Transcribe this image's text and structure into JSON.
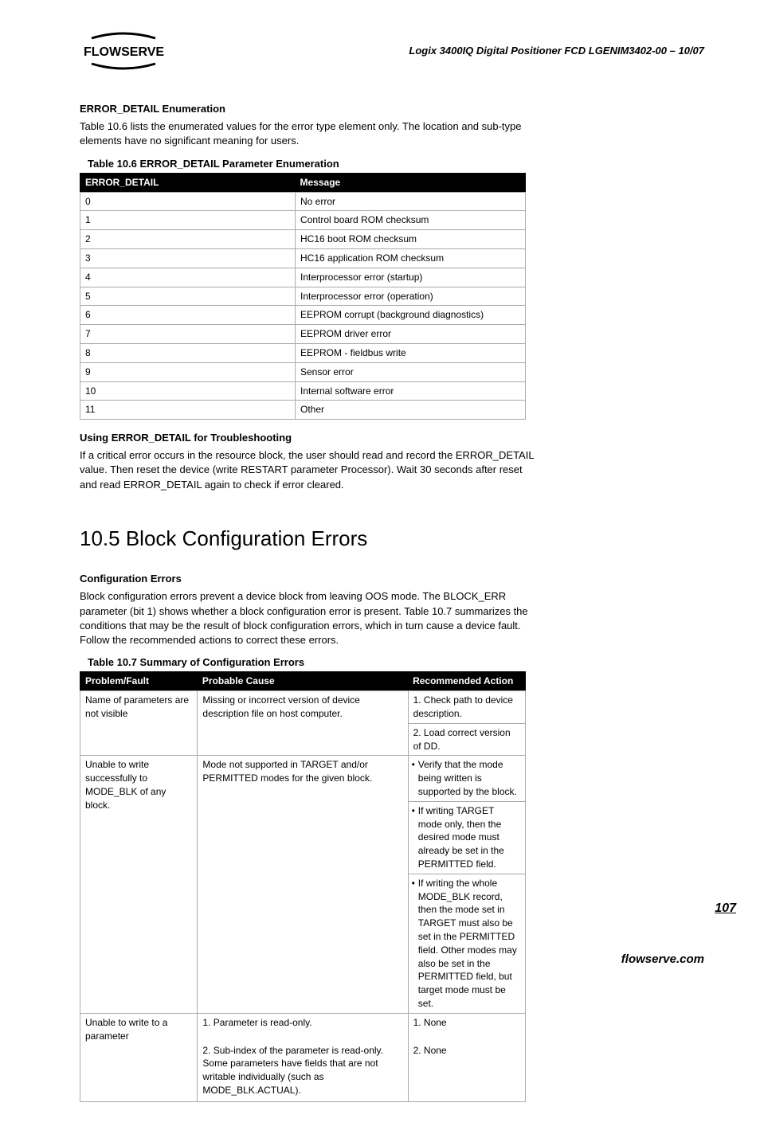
{
  "header": {
    "doc_id": "Logix 3400IQ Digital Positioner   FCD LGENIM3402-00 – 10/07"
  },
  "sec1_title": "ERROR_DETAIL Enumeration",
  "sec1_para": "Table 10.6 lists the enumerated values for the error type element only. The location and sub-type elements have no significant meaning for users.",
  "table106_caption": "Table 10.6 ERROR_DETAIL Parameter Enumeration",
  "table106_head": {
    "c1": "ERROR_DETAIL",
    "c2": "Message"
  },
  "table106_rows": [
    {
      "c1": "0",
      "c2": "No error"
    },
    {
      "c1": "1",
      "c2": "Control board ROM checksum"
    },
    {
      "c1": "2",
      "c2": "HC16 boot ROM checksum"
    },
    {
      "c1": "3",
      "c2": "HC16 application ROM checksum"
    },
    {
      "c1": "4",
      "c2": "Interprocessor error (startup)"
    },
    {
      "c1": "5",
      "c2": "Interprocessor error (operation)"
    },
    {
      "c1": "6",
      "c2": "EEPROM corrupt (background diagnostics)"
    },
    {
      "c1": "7",
      "c2": "EEPROM driver error"
    },
    {
      "c1": "8",
      "c2": "EEPROM - fieldbus write"
    },
    {
      "c1": "9",
      "c2": "Sensor error"
    },
    {
      "c1": "10",
      "c2": "Internal software error"
    },
    {
      "c1": "11",
      "c2": "Other"
    }
  ],
  "sec2_title": "Using ERROR_DETAIL for Troubleshooting",
  "sec2_para": "If a critical error occurs in the resource block, the user should read and record the ERROR_DETAIL value. Then reset the device (write RESTART parameter Processor). Wait 30 seconds after reset and read ERROR_DETAIL again to check if error cleared.",
  "h2": "10.5 Block Configuration Errors",
  "sec3_title": "Configuration Errors",
  "sec3_para": "Block configuration errors prevent a device block from leaving OOS mode. The BLOCK_ERR parameter (bit 1) shows whether a block configuration error is present. Table 10.7 summarizes the conditions that may be the result of block configuration errors, which in turn cause a device fault. Follow the recommended actions to correct these errors.",
  "table107_caption": "Table 10.7 Summary of Configuration Errors",
  "table107_head": {
    "c1": "Problem/Fault",
    "c2": "Probable Cause",
    "c3": "Recommended Action"
  },
  "table107": {
    "r1c1": "Name of parameters are not visible",
    "r1c2": "Missing or incorrect version of device description file on host computer.",
    "r1c3a": "1. Check path to device description.",
    "r1c3b": "2. Load correct version of DD.",
    "r2c1": "Unable to write successfully to MODE_BLK of any block.",
    "r2c2": "Mode not supported in TARGET and/or PERMITTED modes for the given block.",
    "r2c3a": "Verify that the mode being written is supported by the block.",
    "r2c3b": "If writing TARGET mode only, then the desired mode must already be set in the PERMITTED field.",
    "r2c3c": "If writing the whole MODE_BLK record, then the mode set in TARGET must also be set in the PERMITTED field. Other modes may also be set in the PERMITTED field, but target mode must be set.",
    "r3c1": "Unable to write to a parameter",
    "r3c2a": "1. Parameter is read-only.",
    "r3c2b": "2. Sub-index of the parameter is read-only. Some parameters have fields that are not writable individually (such as MODE_BLK.ACTUAL).",
    "r3c3a": "1. None",
    "r3c3b": "2. None"
  },
  "page_num": "107",
  "footer": "flowserve.com"
}
